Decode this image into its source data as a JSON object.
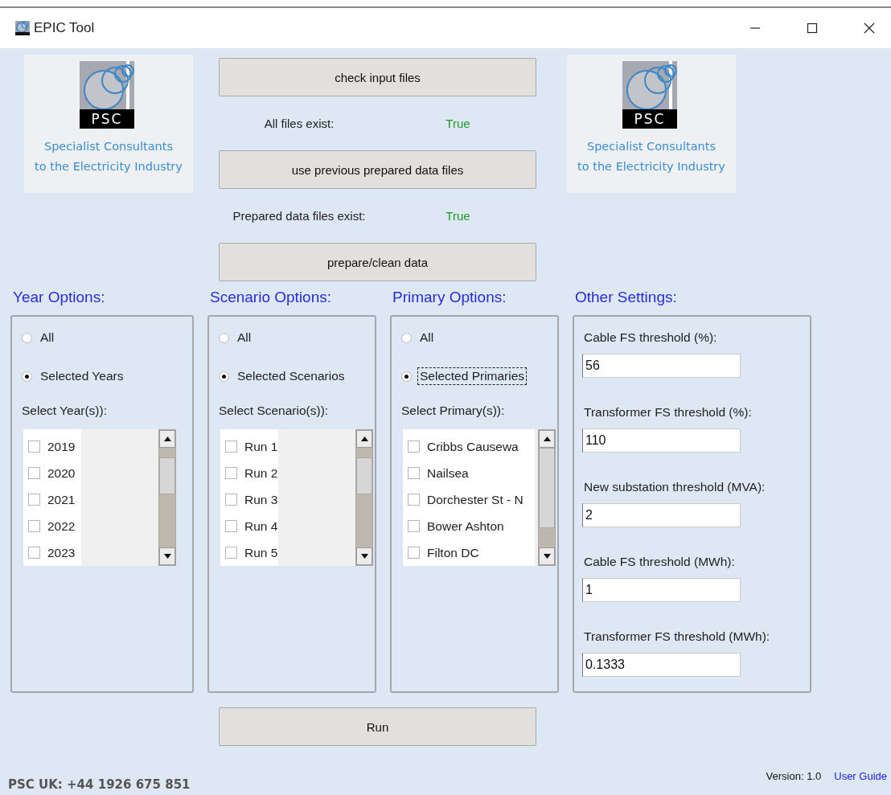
{
  "window": {
    "title": "EPIC Tool"
  },
  "logos": [
    {
      "badge": "PSC",
      "tagline": [
        "Specialist Consultants",
        "to the Electricity Industry"
      ]
    },
    {
      "badge": "PSC",
      "tagline": [
        "Specialist Consultants",
        "to the Electricity Industry"
      ]
    }
  ],
  "actions": [
    {
      "kind": "button",
      "label": "check input files"
    },
    {
      "kind": "status",
      "label": "All files exist:",
      "value": "True"
    },
    {
      "kind": "button",
      "label": "use previous prepared data files"
    },
    {
      "kind": "status",
      "label": "Prepared data files exist:",
      "value": "True"
    },
    {
      "kind": "button",
      "label": "prepare/clean data"
    }
  ],
  "option_panels": [
    {
      "heading": "Year Options:",
      "options": [
        {
          "label": "All",
          "selected": false,
          "focused": false
        },
        {
          "label": "Selected Years",
          "selected": true,
          "focused": false
        }
      ],
      "list_label": "Select Year(s)):",
      "items": [
        {
          "label": "2019",
          "checked": false
        },
        {
          "label": "2020",
          "checked": false
        },
        {
          "label": "2021",
          "checked": false
        },
        {
          "label": "2022",
          "checked": false
        },
        {
          "label": "2023",
          "checked": false
        }
      ]
    },
    {
      "heading": "Scenario Options:",
      "options": [
        {
          "label": "All",
          "selected": false,
          "focused": false
        },
        {
          "label": "Selected Scenarios",
          "selected": true,
          "focused": false
        }
      ],
      "list_label": "Select Scenario(s)):",
      "items": [
        {
          "label": "Run 1",
          "checked": false
        },
        {
          "label": "Run 2",
          "checked": false
        },
        {
          "label": "Run 3",
          "checked": false
        },
        {
          "label": "Run 4",
          "checked": false
        },
        {
          "label": "Run 5",
          "checked": false
        }
      ]
    },
    {
      "heading": "Primary Options:",
      "options": [
        {
          "label": "All",
          "selected": false,
          "focused": false
        },
        {
          "label": "Selected Primaries",
          "selected": true,
          "focused": true
        }
      ],
      "list_label": "Select Primary(s)):",
      "items": [
        {
          "label": "Cribbs Causewa",
          "checked": false
        },
        {
          "label": "Nailsea",
          "checked": false
        },
        {
          "label": "Dorchester St - N",
          "checked": false
        },
        {
          "label": "Bower Ashton",
          "checked": false
        },
        {
          "label": "Filton DC",
          "checked": false
        }
      ]
    }
  ],
  "other_settings": {
    "heading": "Other Settings:",
    "fields": [
      {
        "label": "Cable FS threshold (%):",
        "value": "56"
      },
      {
        "label": "Transformer FS threshold (%):",
        "value": "110"
      },
      {
        "label": "New substation threshold (MVA):",
        "value": "2"
      },
      {
        "label": "Cable FS threshold (MWh):",
        "value": "1"
      },
      {
        "label": "Transformer FS threshold (MWh):",
        "value": "0.1333"
      }
    ]
  },
  "run_button": "Run",
  "footer": {
    "contact": "PSC UK:  +44 1926 675 851",
    "version": "Version: 1.0",
    "link": "User Guide"
  }
}
